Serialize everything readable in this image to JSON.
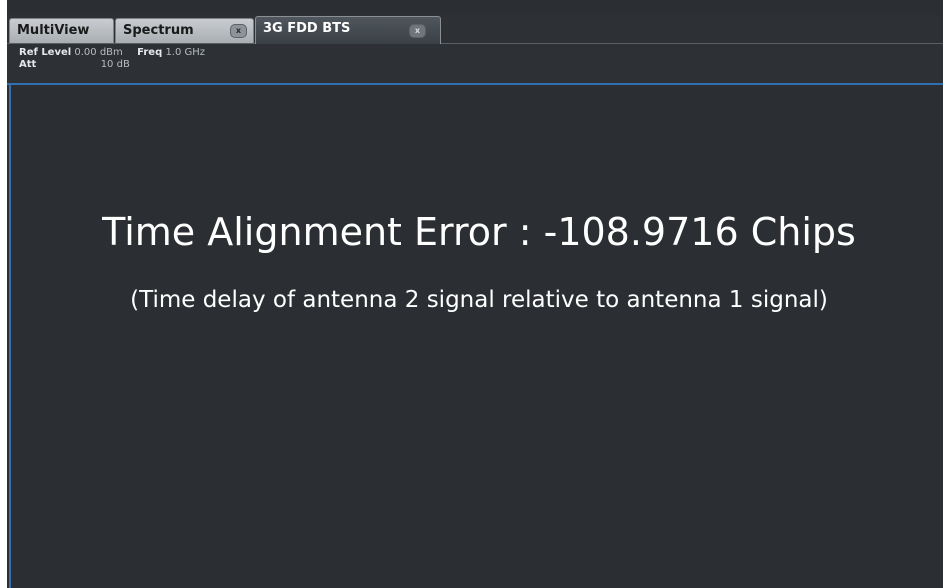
{
  "tabs": [
    {
      "label": "MultiView"
    },
    {
      "label": "Spectrum",
      "close": "x"
    },
    {
      "label": "3G FDD BTS",
      "close": "x"
    }
  ],
  "info": {
    "ref_level_label": "Ref Level",
    "ref_level_value": "0.00 dBm",
    "freq_label": "Freq",
    "freq_value": "1.0 GHz",
    "att_label": "Att",
    "att_value": "10 dB"
  },
  "result": {
    "headline": "Time Alignment Error : -108.9716 Chips",
    "subline": "(Time delay of antenna 2 signal relative to antenna 1 signal)"
  },
  "colors": {
    "background": "#2b2f33",
    "accent": "#2f6fb2",
    "text": "#ffffff"
  }
}
